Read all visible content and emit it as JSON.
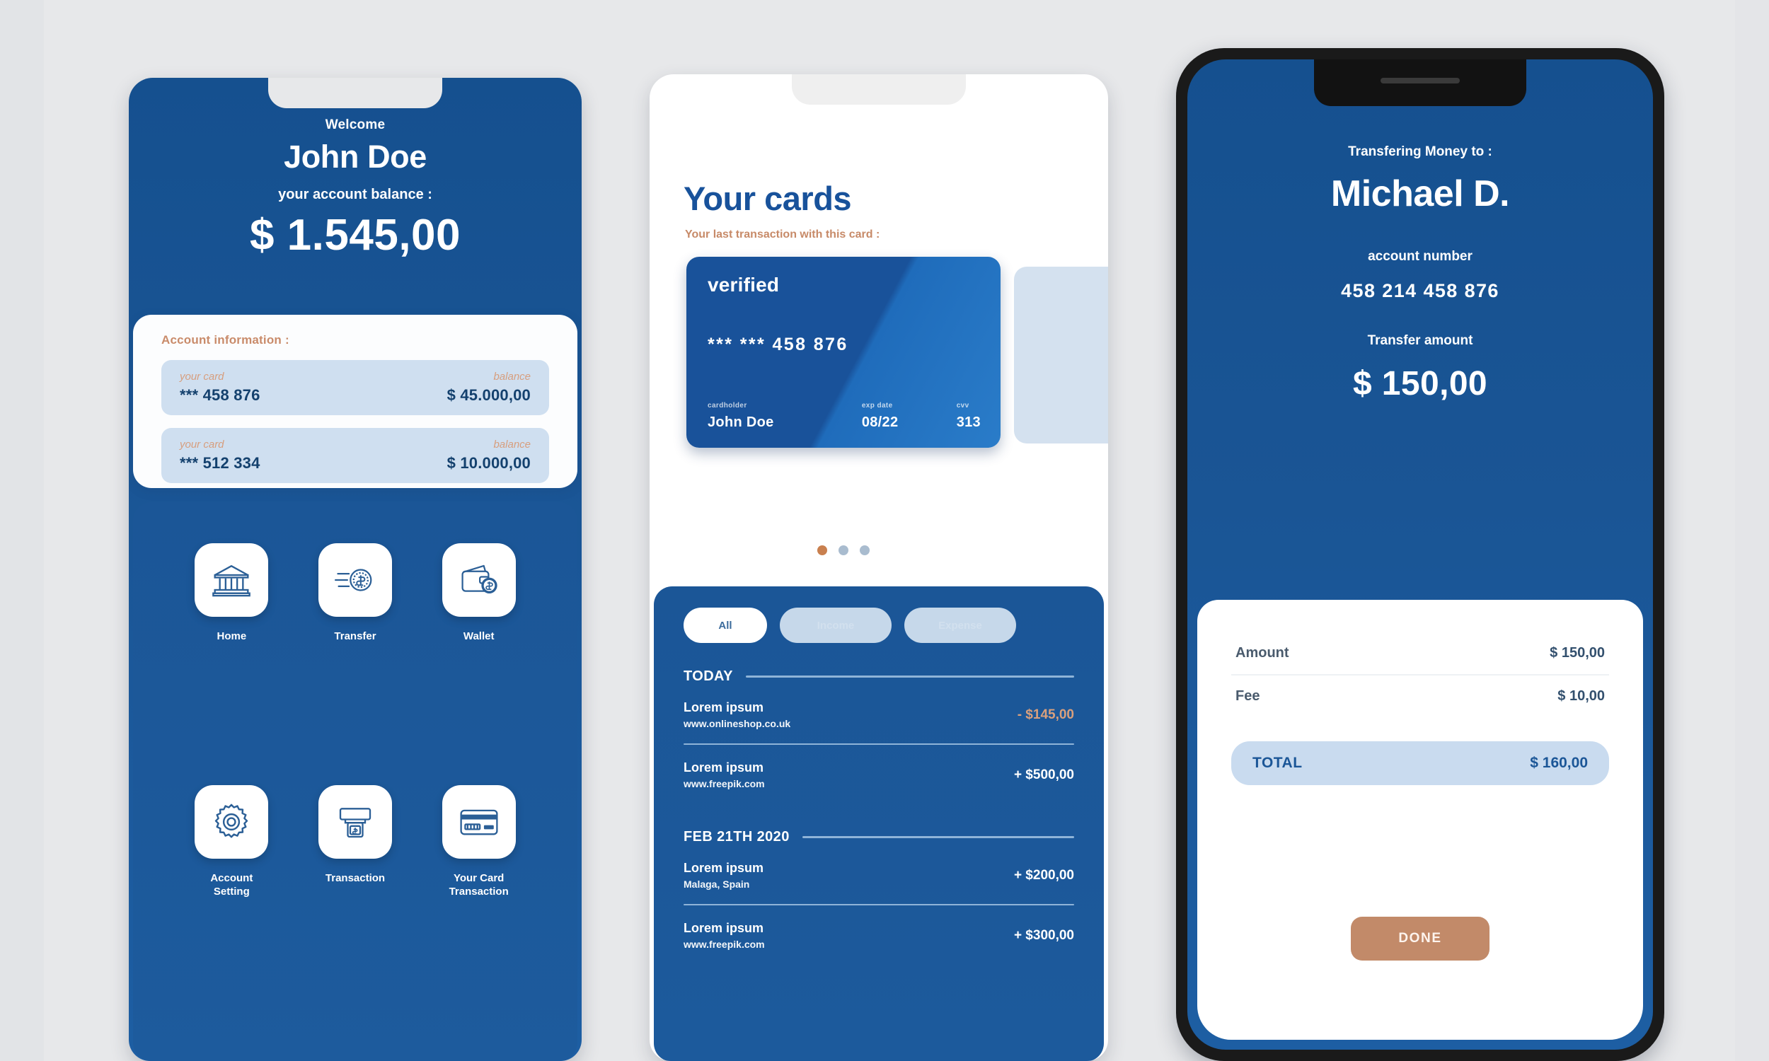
{
  "theme": {
    "brand_blue": "#1b5697",
    "deep_blue": "#15508f",
    "accent_terracotta": "#c28a69",
    "light_blue": "#cfdff0",
    "page_bg": "#e7e8ea"
  },
  "screen1": {
    "welcome": "Welcome",
    "name": "John Doe",
    "balance_label": "your account balance :",
    "balance": "$ 1.545,00",
    "account_info": {
      "title": "Account information :",
      "col_card_label": "your card",
      "col_balance_label": "balance",
      "rows": [
        {
          "card_label": "your card",
          "card": "*** 458 876",
          "balance_label": "balance",
          "balance": "$ 45.000,00"
        },
        {
          "card_label": "your card",
          "card": "*** 512 334",
          "balance_label": "balance",
          "balance": "$ 10.000,00"
        }
      ]
    },
    "menu": [
      {
        "label": "Home",
        "icon": "bank-icon"
      },
      {
        "label": "Transfer",
        "icon": "money-transfer-icon"
      },
      {
        "label": "Wallet",
        "icon": "wallet-icon"
      },
      {
        "label": "Account\nSetting",
        "icon": "gear-icon"
      },
      {
        "label": "Transaction",
        "icon": "atm-icon"
      },
      {
        "label": "Your Card\nTransaction",
        "icon": "credit-card-icon"
      }
    ]
  },
  "screen2": {
    "title": "Your cards",
    "subtitle": "Your last transaction with this card :",
    "card": {
      "status": "verified",
      "number": "*** *** 458 876",
      "holder_label": "cardholder",
      "holder": "John Doe",
      "exp_label": "exp date",
      "exp": "08/22",
      "cvv_label": "cvv",
      "cvv": "313"
    },
    "pagination": {
      "count": 3,
      "active_index": 0
    },
    "filters": [
      {
        "label": "All",
        "active": true
      },
      {
        "label": "Income",
        "active": false
      },
      {
        "label": "Expense",
        "active": false
      }
    ],
    "sections": [
      {
        "heading": "TODAY",
        "transactions": [
          {
            "title": "Lorem ipsum",
            "sub": "www.onlineshop.co.uk",
            "amount": "- $145,00",
            "sign": "neg"
          },
          {
            "title": "Lorem ipsum",
            "sub": "www.freepik.com",
            "amount": "+ $500,00",
            "sign": "pos"
          }
        ]
      },
      {
        "heading": "FEB 21TH 2020",
        "transactions": [
          {
            "title": "Lorem ipsum",
            "sub": "Malaga, Spain",
            "amount": "+ $200,00",
            "sign": "pos"
          },
          {
            "title": "Lorem ipsum",
            "sub": "www.freepik.com",
            "amount": "+ $300,00",
            "sign": "pos"
          }
        ]
      }
    ]
  },
  "screen3": {
    "to_label": "Transfering Money to :",
    "to_name": "Michael D.",
    "account_label": "account number",
    "account_number": "458 214 458 876",
    "amount_label": "Transfer amount",
    "amount": "$ 150,00",
    "summary": [
      {
        "label": "Amount",
        "value": "$ 150,00"
      },
      {
        "label": "Fee",
        "value": "$ 10,00"
      }
    ],
    "total_label": "TOTAL",
    "total_value": "$ 160,00",
    "done_label": "DONE"
  }
}
